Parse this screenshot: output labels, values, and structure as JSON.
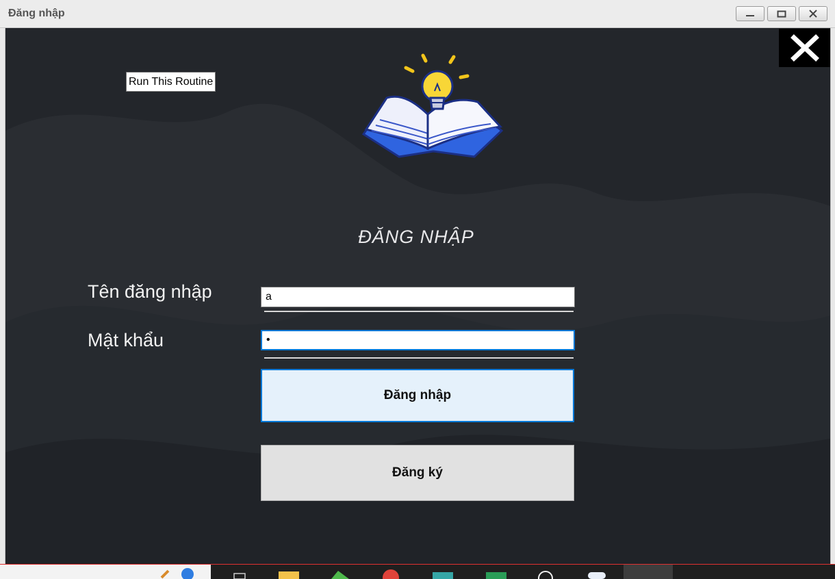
{
  "window": {
    "title": "Đăng nhập"
  },
  "tooltip": {
    "text": "Run This Routine"
  },
  "form": {
    "heading": "ĐĂNG NHẬP",
    "username_label": "Tên đăng nhập",
    "username_value": "a",
    "password_label": "Mật khẩu",
    "password_value": "•",
    "login_button": "Đăng nhập",
    "register_button": "Đăng ký"
  },
  "icons": {
    "logo": "book-lightbulb-icon",
    "app_close": "close-icon"
  },
  "colors": {
    "background": "#23262b",
    "accent": "#0078d7",
    "login_button_bg": "#e5f1fb",
    "register_button_bg": "#e1e1e1"
  }
}
